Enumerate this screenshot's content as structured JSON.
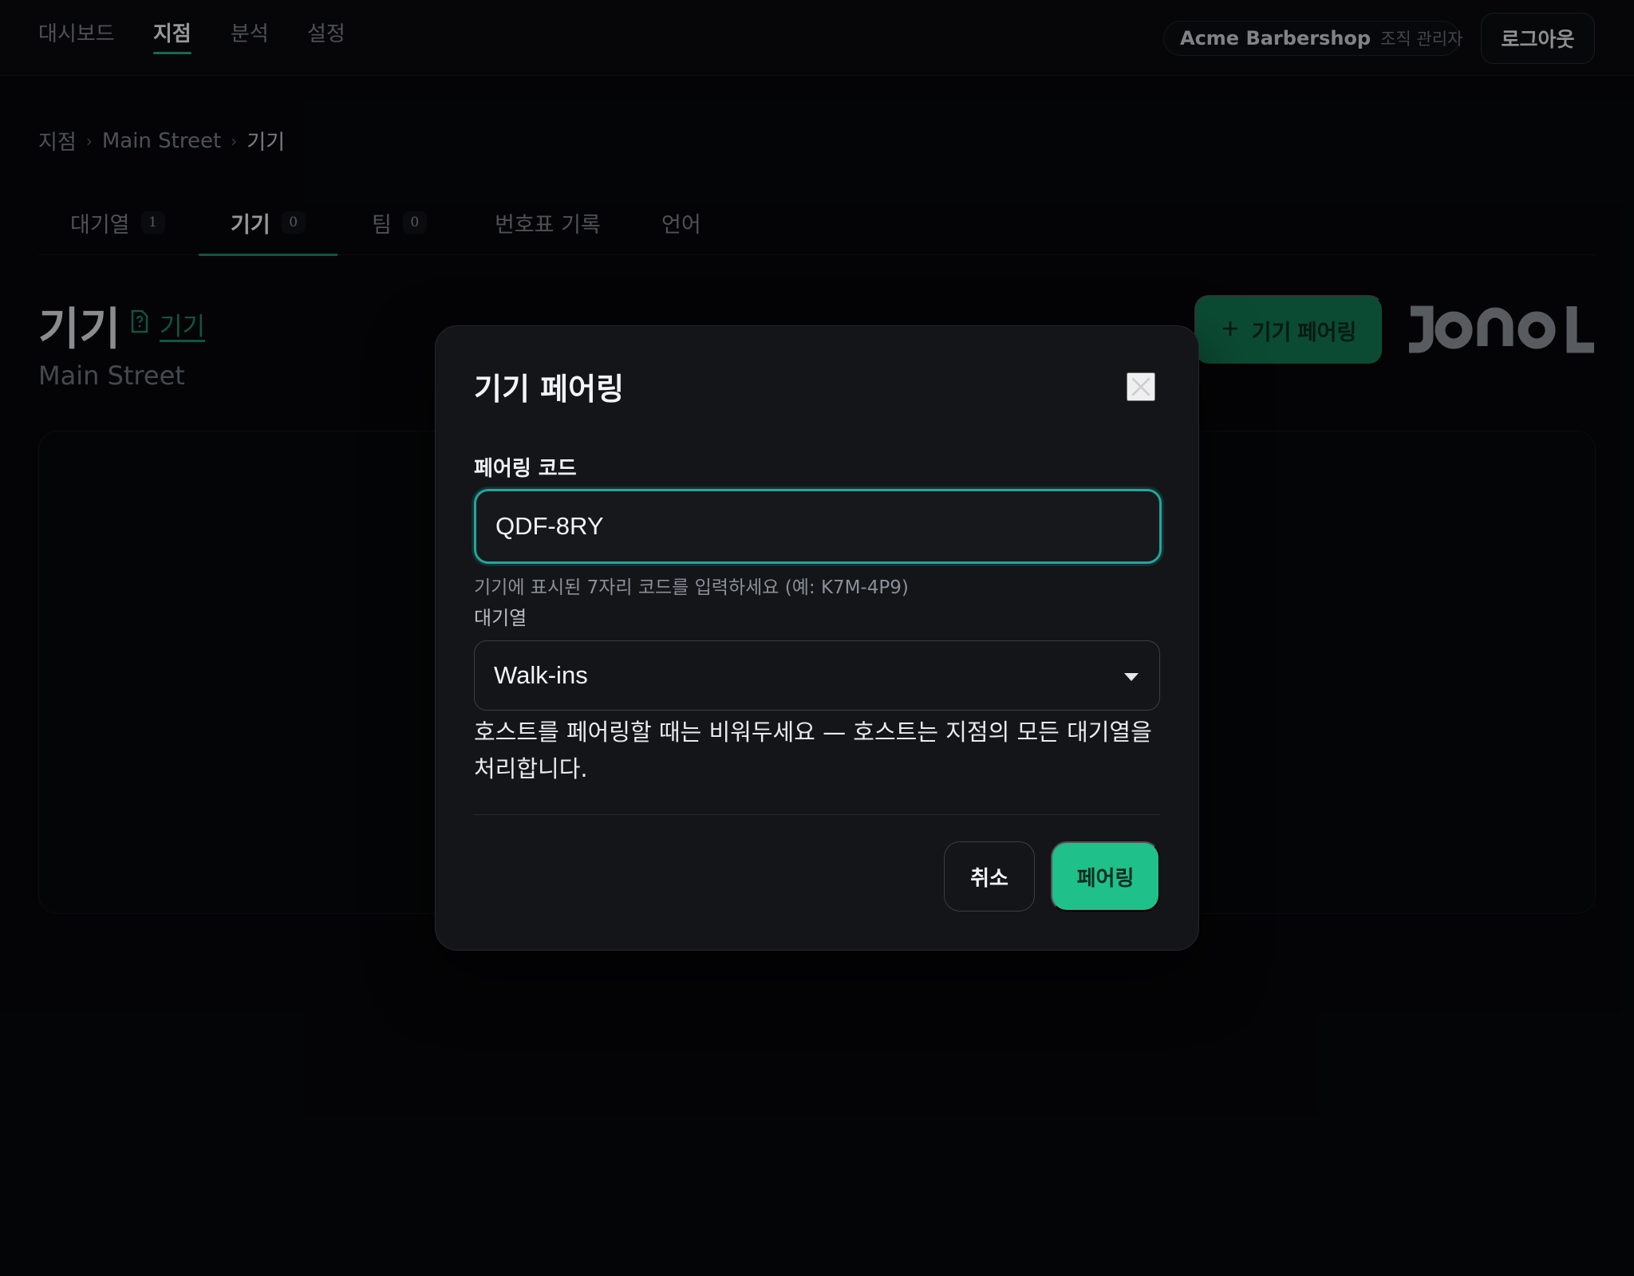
{
  "nav": {
    "items": [
      {
        "label": "대시보드",
        "active": false
      },
      {
        "label": "지점",
        "active": true
      },
      {
        "label": "분석",
        "active": false
      },
      {
        "label": "설정",
        "active": false
      }
    ],
    "org_name": "Acme Barbershop",
    "org_role": "조직 관리자",
    "logout_label": "로그아웃"
  },
  "breadcrumb": {
    "items": [
      "지점",
      "Main Street",
      "기기"
    ],
    "separator": "›"
  },
  "tabs": [
    {
      "label": "대기열",
      "count": "1",
      "active": false
    },
    {
      "label": "기기",
      "count": "0",
      "active": true
    },
    {
      "label": "팀",
      "count": "0",
      "active": false
    },
    {
      "label": "번호표 기록",
      "count": null,
      "active": false
    },
    {
      "label": "언어",
      "count": null,
      "active": false
    }
  ],
  "page": {
    "title": "기기",
    "help_link": "기기",
    "subtitle": "Main Street",
    "pair_button_label": "기기 페어링",
    "brand_logo": "JONOL"
  },
  "modal": {
    "title": "기기 페어링",
    "code_label": "페어링 코드",
    "code_value": "QDF-8RY",
    "code_hint": "기기에 표시된 7자리 코드를 입력하세요 (예: K7M-4P9)",
    "queue_label": "대기열",
    "queue_value": "Walk-ins",
    "note": "호스트를 페어링할 때는 비워두세요 — 호스트는 지점의 모든 대기열을 처리합니다.",
    "cancel_label": "취소",
    "confirm_label": "페어링"
  },
  "colors": {
    "accent": "#1fc08a",
    "focus_ring": "#1fa89a",
    "background": "#07080a",
    "modal_bg": "#131519"
  }
}
